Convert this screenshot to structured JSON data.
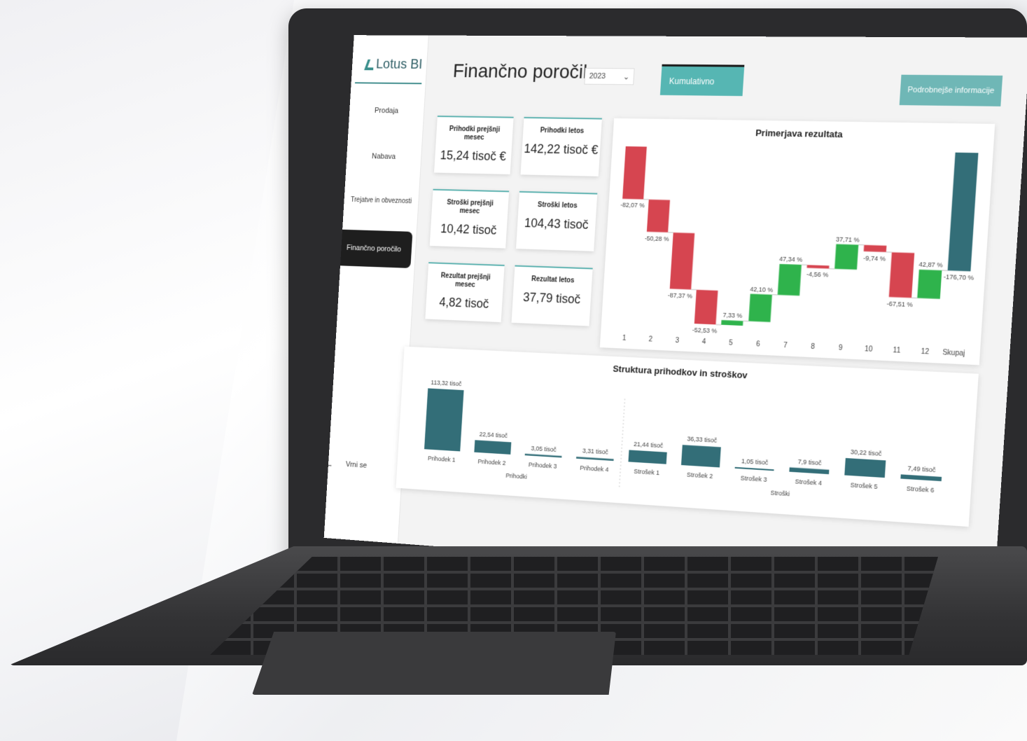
{
  "app": {
    "brand": "Lotus BI",
    "page_title": "Finančno poročilo",
    "year": "2023",
    "cumulative_button": "Kumulativno",
    "more_info_button": "Podrobnejše informacije",
    "back_label": "Vrni se"
  },
  "sidebar": {
    "items": [
      {
        "label": "Prodaja"
      },
      {
        "label": "Nabava"
      },
      {
        "label": "Trejatve in obveznosti"
      },
      {
        "label": "Finančno poročilo",
        "active": true
      }
    ]
  },
  "kpis": [
    {
      "label": "Prihodki prejšnji mesec",
      "value": "15,24 tisoč €"
    },
    {
      "label": "Prihodki letos",
      "value": "142,22 tisoč €"
    },
    {
      "label": "Stroški prejšnji mesec",
      "value": "10,42 tisoč"
    },
    {
      "label": "Stroški letos",
      "value": "104,43 tisoč"
    },
    {
      "label": "Rezultat prejšnji mesec",
      "value": "4,82 tisoč"
    },
    {
      "label": "Rezultat letos",
      "value": "37,79 tisoč"
    }
  ],
  "colors": {
    "teal": "#336e78",
    "red": "#d64550",
    "green": "#2fb34c",
    "accent": "#56b6b3"
  },
  "chart_data": [
    {
      "type": "waterfall",
      "title": "Primerjava rezultata",
      "categories": [
        "1",
        "2",
        "3",
        "4",
        "5",
        "6",
        "7",
        "8",
        "9",
        "10",
        "11",
        "12",
        "Skupaj"
      ],
      "values": [
        -82.07,
        -50.28,
        -87.37,
        -52.53,
        7.33,
        42.1,
        47.34,
        -4.56,
        37.71,
        -9.74,
        -67.51,
        42.87,
        -176.7
      ],
      "labels": [
        "-82,07 %",
        "-50,28 %",
        "-87,37 %",
        "-52,53 %",
        "7,33 %",
        "42,10 %",
        "47,34 %",
        "-4,56 %",
        "37,71 %",
        "-9,74 %",
        "-67,51 %",
        "42,87 %",
        "-176,70 %"
      ],
      "total_category": "Skupaj"
    },
    {
      "type": "bar",
      "title": "Struktura prihodkov in stroškov",
      "groups": [
        {
          "name": "Prihodki",
          "categories": [
            "Prihodek 1",
            "Prihodek 2",
            "Prihodek 3",
            "Prihodek 4"
          ],
          "values": [
            113.32,
            22.54,
            3.05,
            3.31
          ],
          "labels": [
            "113,32 tisoč",
            "22,54 tisoč",
            "3,05 tisoč",
            "3,31 tisoč"
          ]
        },
        {
          "name": "Stroški",
          "categories": [
            "Strošek 1",
            "Strošek 2",
            "Strošek 3",
            "Strošek 4",
            "Strošek 5",
            "Strošek 6"
          ],
          "values": [
            21.44,
            36.33,
            1.05,
            7.9,
            30.22,
            7.49
          ],
          "labels": [
            "21,44 tisoč",
            "36,33 tisoč",
            "1,05 tisoč",
            "7,9 tisoč",
            "30,22 tisoč",
            "7,49 tisoč"
          ]
        }
      ]
    }
  ]
}
